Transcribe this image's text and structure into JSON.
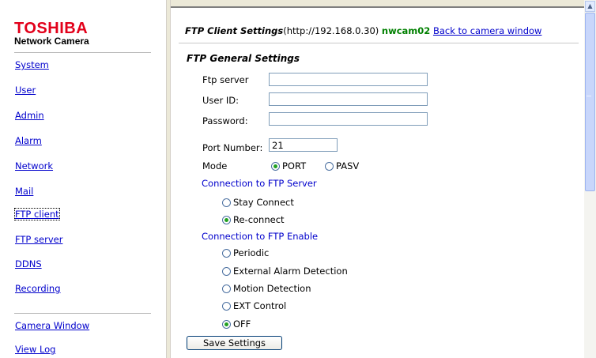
{
  "nav": {
    "logo": "TOSHIBA",
    "logo_sub": "Network Camera",
    "items": [
      {
        "label": "System"
      },
      {
        "label": "User"
      },
      {
        "label": "Admin"
      },
      {
        "label": "Alarm"
      },
      {
        "label": "Network"
      },
      {
        "label": "Mail"
      },
      {
        "label": "FTP client"
      },
      {
        "label": "FTP server"
      },
      {
        "label": "DDNS"
      },
      {
        "label": "Recording"
      }
    ],
    "bottom": [
      {
        "label": "Camera Window"
      },
      {
        "label": "View Log"
      }
    ]
  },
  "header": {
    "title": "FTP Client Settings",
    "url": "(http://192.168.0.30)",
    "camera": "nwcam02",
    "back_link": "Back to camera window"
  },
  "section": "FTP General Settings",
  "fields": {
    "ftp_server_label": "Ftp server",
    "ftp_server_value": "",
    "user_id_label": "User ID:",
    "user_id_value": "",
    "password_label": "Password:",
    "password_value": "",
    "port_label": "Port Number:",
    "port_value": "21",
    "mode_label": "Mode",
    "mode_options": [
      "PORT",
      "PASV"
    ],
    "mode_selected": "PORT"
  },
  "connection_server": {
    "heading": "Connection to FTP Server",
    "options": [
      "Stay Connect",
      "Re-connect"
    ],
    "selected": "Re-connect"
  },
  "connection_enable": {
    "heading": "Connection to FTP Enable",
    "options": [
      "Periodic",
      "External Alarm Detection",
      "Motion Detection",
      "EXT Control",
      "OFF"
    ],
    "selected": "OFF"
  },
  "save_button": "Save Settings"
}
